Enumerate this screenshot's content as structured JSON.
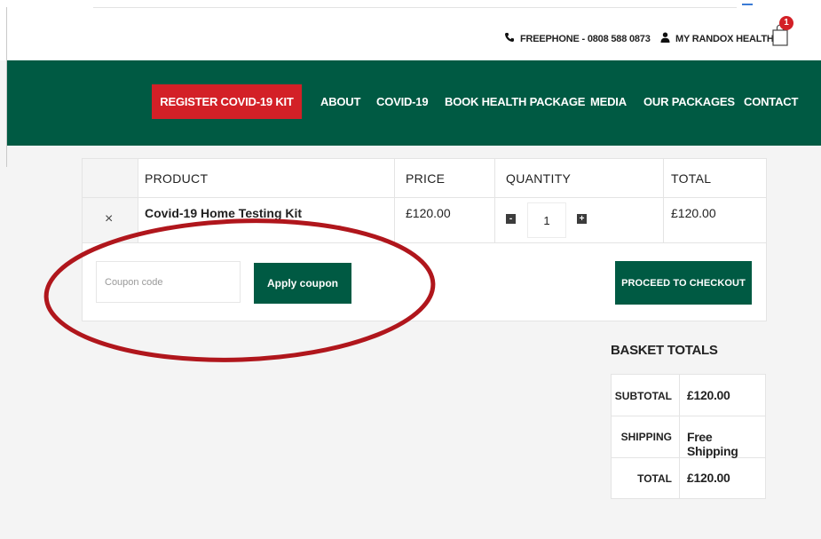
{
  "topbar": {
    "phone_label": "FREEPHONE - 0808 588 0873",
    "account_label": "MY RANDOX HEALTH",
    "cart_count": "1"
  },
  "nav": {
    "register": "REGISTER COVID-19 KIT",
    "links": [
      "ABOUT",
      "COVID-19",
      "BOOK HEALTH PACKAGE",
      "MEDIA",
      "OUR PACKAGES",
      "CONTACT"
    ]
  },
  "cart": {
    "headers": {
      "product": "PRODUCT",
      "price": "PRICE",
      "quantity": "QUANTITY",
      "total": "TOTAL"
    },
    "items": [
      {
        "remove": "×",
        "name": "Covid-19 Home Testing Kit",
        "price": "£120.00",
        "quantity": "1",
        "minus": "-",
        "plus": "+",
        "total": "£120.00"
      }
    ],
    "coupon_placeholder": "Coupon code",
    "apply_label": "Apply coupon",
    "checkout_label": "PROCEED TO CHECKOUT"
  },
  "basket_totals": {
    "title": "BASKET TOTALS",
    "subtotal_label": "SUBTOTAL",
    "subtotal_value": "£120.00",
    "shipping_label": "SHIPPING",
    "shipping_value": "Free Shipping",
    "total_label": "TOTAL",
    "total_value": "£120.00"
  },
  "colors": {
    "brand_green": "#005a43",
    "brand_red": "#d32027",
    "annotation_red": "#b0161c"
  },
  "icons": {
    "phone": "phone-icon",
    "account": "user-icon",
    "cart": "shopping-bag-icon"
  }
}
